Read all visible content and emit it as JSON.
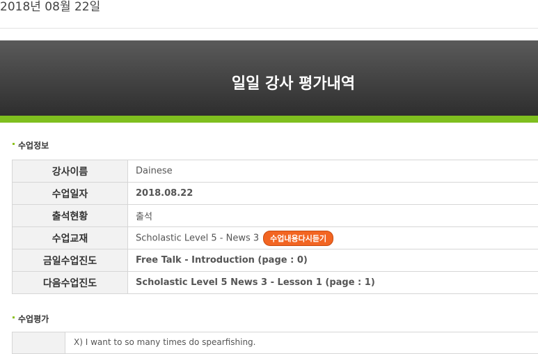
{
  "date": "2018년 08월 22일",
  "banner": {
    "title": "일일 강사 평가내역"
  },
  "class_info": {
    "section_title": "수업정보",
    "rows": {
      "instructor": {
        "label": "강사이름",
        "value": "Dainese"
      },
      "date": {
        "label": "수업일자",
        "value": "2018.08.22"
      },
      "attendance": {
        "label": "출석현황",
        "value": "출석"
      },
      "material": {
        "label": "수업교재",
        "value": "Scholastic Level 5 - News 3",
        "button": "수업내용다시듣기"
      },
      "today_progress": {
        "label": "금일수업진도",
        "value": "Free Talk - Introduction (page : 0)"
      },
      "next_progress": {
        "label": "다음수업진도",
        "value": "Scholastic Level 5 News 3 - Lesson 1 (page : 1)"
      }
    }
  },
  "evaluation": {
    "section_title": "수업평가",
    "first_line": "X) I want to so many times do spearfishing."
  },
  "colors": {
    "green_bar": "#7fbf1f",
    "progress_green": "#3a8a14",
    "progress_orange": "#e46c0a",
    "replay_button": "#f26522"
  }
}
